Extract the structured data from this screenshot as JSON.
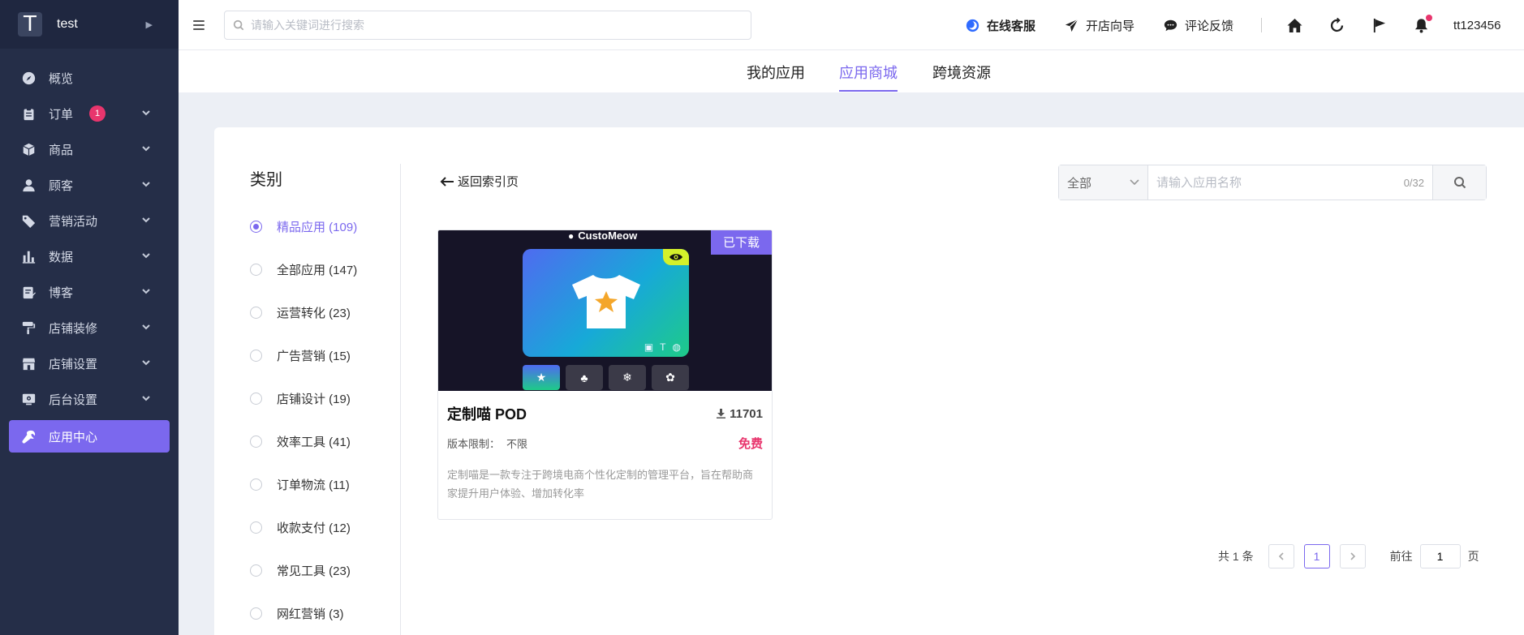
{
  "brand": {
    "logo_letter": "T",
    "name": "test"
  },
  "sidebar": {
    "items": [
      {
        "label": "概览",
        "icon": "compass-icon",
        "badge": null,
        "expandable": false
      },
      {
        "label": "订单",
        "icon": "clipboard-icon",
        "badge": "1",
        "expandable": true
      },
      {
        "label": "商品",
        "icon": "box-icon",
        "badge": null,
        "expandable": true
      },
      {
        "label": "顾客",
        "icon": "user-icon",
        "badge": null,
        "expandable": true
      },
      {
        "label": "营销活动",
        "icon": "tag-icon",
        "badge": null,
        "expandable": true
      },
      {
        "label": "数据",
        "icon": "bar-chart-icon",
        "badge": null,
        "expandable": true
      },
      {
        "label": "博客",
        "icon": "document-edit-icon",
        "badge": null,
        "expandable": true
      },
      {
        "label": "店铺装修",
        "icon": "paint-roller-icon",
        "badge": null,
        "expandable": true
      },
      {
        "label": "店铺设置",
        "icon": "store-icon",
        "badge": null,
        "expandable": true
      },
      {
        "label": "后台设置",
        "icon": "monitor-gear-icon",
        "badge": null,
        "expandable": true
      }
    ],
    "active_item": {
      "label": "应用中心",
      "icon": "wrench-icon"
    }
  },
  "topbar": {
    "search_placeholder": "请输入关键词进行搜索",
    "links": [
      {
        "label": "在线客服",
        "icon": "chat-bubble-icon",
        "bold": true
      },
      {
        "label": "开店向导",
        "icon": "paper-plane-icon",
        "bold": false
      },
      {
        "label": "评论反馈",
        "icon": "comment-icon",
        "bold": false
      }
    ],
    "icons": [
      "home-icon",
      "refresh-icon",
      "flag-icon",
      "bell-icon"
    ],
    "username": "tt123456"
  },
  "tabs": [
    {
      "label": "我的应用",
      "active": false
    },
    {
      "label": "应用商城",
      "active": true
    },
    {
      "label": "跨境资源",
      "active": false
    }
  ],
  "categories": {
    "title": "类别",
    "items": [
      {
        "label": "精品应用 (109)",
        "selected": true
      },
      {
        "label": "全部应用 (147)",
        "selected": false
      },
      {
        "label": "运营转化 (23)",
        "selected": false
      },
      {
        "label": "广告营销 (15)",
        "selected": false
      },
      {
        "label": "店铺设计 (19)",
        "selected": false
      },
      {
        "label": "效率工具 (41)",
        "selected": false
      },
      {
        "label": "订单物流 (11)",
        "selected": false
      },
      {
        "label": "收款支付 (12)",
        "selected": false
      },
      {
        "label": "常见工具 (23)",
        "selected": false
      },
      {
        "label": "网红营销 (3)",
        "selected": false
      }
    ]
  },
  "back_link": "返回索引页",
  "filter": {
    "select_value": "全部",
    "input_placeholder": "请输入应用名称",
    "counter": "0/32"
  },
  "app": {
    "ribbon": "已下载",
    "banner_brand": "CustoMeow",
    "name": "定制喵 POD",
    "downloads": "11701",
    "version_label": "版本限制：",
    "version_value": "不限",
    "price": "免费",
    "description": "定制喵是一款专注于跨境电商个性化定制的管理平台，旨在帮助商家提升用户体验、增加转化率"
  },
  "pagination": {
    "total": "共 1 条",
    "current_page": "1",
    "goto_prefix": "前往",
    "goto_value": "1",
    "goto_suffix": "页"
  },
  "colors": {
    "accent": "#7b68ee",
    "sidebar_bg": "#252e48",
    "badge": "#e8356d"
  }
}
